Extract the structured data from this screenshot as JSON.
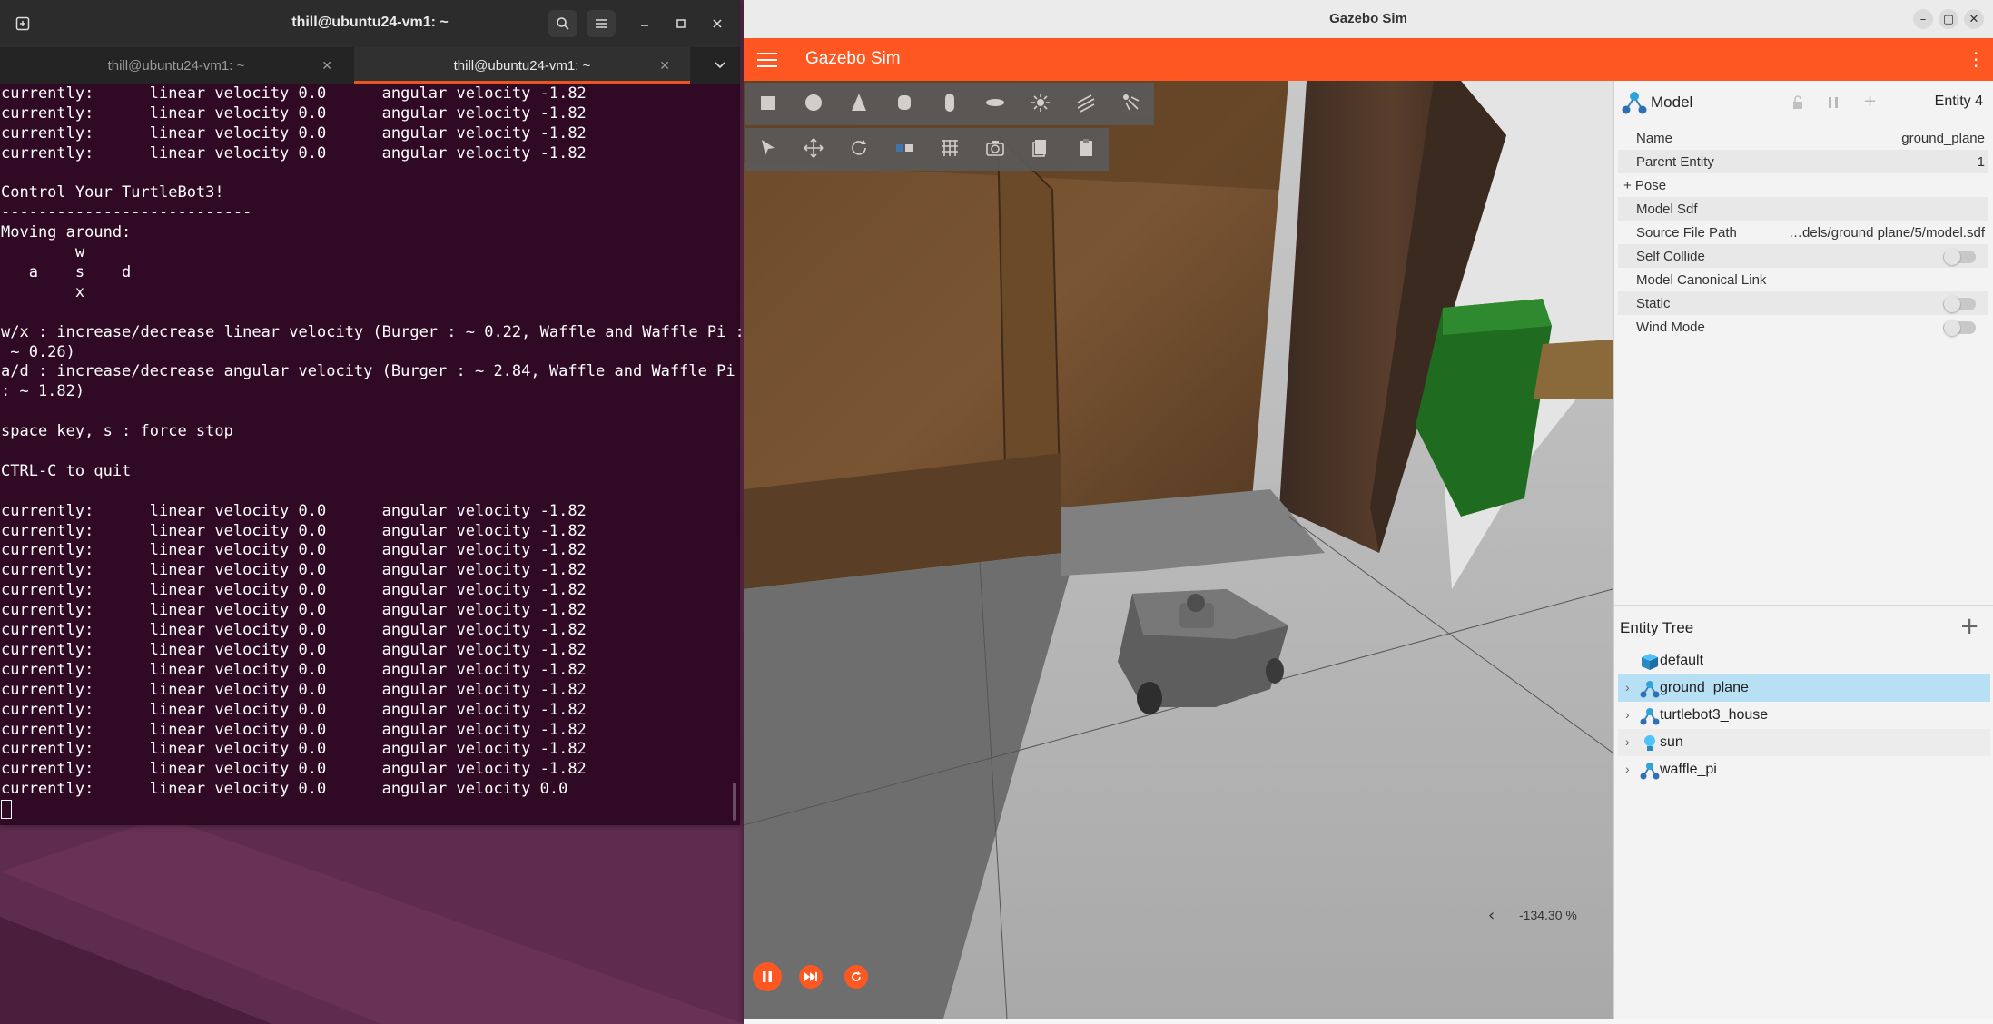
{
  "terminal": {
    "title": "thill@ubuntu24-vm1: ~",
    "tabs": [
      {
        "label": "thill@ubuntu24-vm1: ~",
        "active": false
      },
      {
        "label": "thill@ubuntu24-vm1: ~",
        "active": true
      }
    ],
    "lines": [
      "currently:      linear velocity 0.0      angular velocity -1.82",
      "currently:      linear velocity 0.0      angular velocity -1.82",
      "currently:      linear velocity 0.0      angular velocity -1.82",
      "currently:      linear velocity 0.0      angular velocity -1.82",
      "",
      "Control Your TurtleBot3!",
      "---------------------------",
      "Moving around:",
      "        w",
      "   a    s    d",
      "        x",
      "",
      "w/x : increase/decrease linear velocity (Burger : ~ 0.22, Waffle and Waffle Pi :",
      " ~ 0.26)",
      "a/d : increase/decrease angular velocity (Burger : ~ 2.84, Waffle and Waffle Pi",
      ": ~ 1.82)",
      "",
      "space key, s : force stop",
      "",
      "CTRL-C to quit",
      "",
      "currently:      linear velocity 0.0      angular velocity -1.82",
      "currently:      linear velocity 0.0      angular velocity -1.82",
      "currently:      linear velocity 0.0      angular velocity -1.82",
      "currently:      linear velocity 0.0      angular velocity -1.82",
      "currently:      linear velocity 0.0      angular velocity -1.82",
      "currently:      linear velocity 0.0      angular velocity -1.82",
      "currently:      linear velocity 0.0      angular velocity -1.82",
      "currently:      linear velocity 0.0      angular velocity -1.82",
      "currently:      linear velocity 0.0      angular velocity -1.82",
      "currently:      linear velocity 0.0      angular velocity -1.82",
      "currently:      linear velocity 0.0      angular velocity -1.82",
      "currently:      linear velocity 0.0      angular velocity -1.82",
      "currently:      linear velocity 0.0      angular velocity -1.82",
      "currently:      linear velocity 0.0      angular velocity -1.82",
      "currently:      linear velocity 0.0      angular velocity 0.0"
    ]
  },
  "gazebo": {
    "window_title": "Gazebo Sim",
    "app_title": "Gazebo Sim",
    "accent": "#ff5722",
    "zoom_readout": "-134.30 %",
    "toolbar_row1": [
      "box-icon",
      "sphere-icon",
      "cone-icon",
      "cylinder-icon",
      "capsule-icon",
      "ellipsoid-icon",
      "point-light-icon",
      "directional-light-icon",
      "spot-light-icon"
    ],
    "toolbar_row2": [
      "select-icon",
      "translate-icon",
      "rotate-icon",
      "snap-icon",
      "grid-icon",
      "screenshot-icon",
      "copy-icon",
      "paste-icon"
    ],
    "component": {
      "title": "Model",
      "entity": "Entity 4",
      "rows": [
        {
          "key": "Name",
          "value": "ground_plane"
        },
        {
          "key": "Parent Entity",
          "value": "1"
        },
        {
          "key": "+ Pose",
          "value": ""
        },
        {
          "key": "Model Sdf",
          "value": ""
        },
        {
          "key": "Source File Path",
          "value": "…dels/ground plane/5/model.sdf"
        },
        {
          "key": "Self Collide",
          "value": ""
        },
        {
          "key": "Model Canonical Link",
          "value": ""
        },
        {
          "key": "Static",
          "value": ""
        },
        {
          "key": "Wind Mode",
          "value": ""
        }
      ]
    },
    "entity_tree": {
      "title": "Entity Tree",
      "items": [
        {
          "label": "default",
          "icon": "world-cube-icon"
        },
        {
          "label": "ground_plane",
          "icon": "model-icon"
        },
        {
          "label": "turtlebot3_house",
          "icon": "model-icon"
        },
        {
          "label": "sun",
          "icon": "light-bulb-icon"
        },
        {
          "label": "waffle_pi",
          "icon": "model-icon"
        }
      ]
    }
  }
}
